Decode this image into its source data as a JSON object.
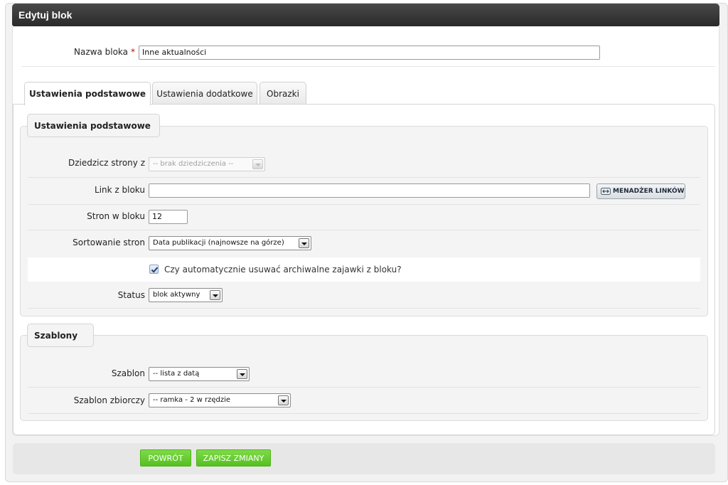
{
  "window": {
    "title": "Edytuj blok"
  },
  "name_field": {
    "label": "Nazwa bloka",
    "required_mark": "*",
    "value": "Inne aktualności"
  },
  "tabs": [
    {
      "label": "Ustawienia podstawowe",
      "active": true
    },
    {
      "label": "Ustawienia dodatkowe",
      "active": false
    },
    {
      "label": "Obrazki",
      "active": false
    }
  ],
  "basic_settings": {
    "legend": "Ustawienia podstawowe",
    "inherit": {
      "label": "Dziedzicz strony z",
      "value": "-- brak dziedziczenia --",
      "disabled": true
    },
    "link": {
      "label": "Link z bloku",
      "value": "",
      "button_label": "MENADŻER LINKÓW"
    },
    "pages_count": {
      "label": "Stron w bloku",
      "value": "12"
    },
    "sorting": {
      "label": "Sortowanie stron",
      "value": "Data publikacji (najnowsze na górze)"
    },
    "auto_remove": {
      "label": "Czy automatycznie usuwać archiwalne zajawki z bloku?",
      "checked": true
    },
    "status": {
      "label": "Status",
      "value": "blok aktywny"
    }
  },
  "templates": {
    "legend": "Szablony",
    "template": {
      "label": "Szablon",
      "value": "-- lista z datą"
    },
    "collective_template": {
      "label": "Szablon zbiorczy",
      "value": "-- ramka - 2 w rzędzie"
    }
  },
  "footer": {
    "back_label": "POWRÓT",
    "save_label": "ZAPISZ ZMIANY"
  },
  "colors": {
    "accent_green": "#5ec826",
    "titlebar": "#333333",
    "required": "#d00000"
  }
}
